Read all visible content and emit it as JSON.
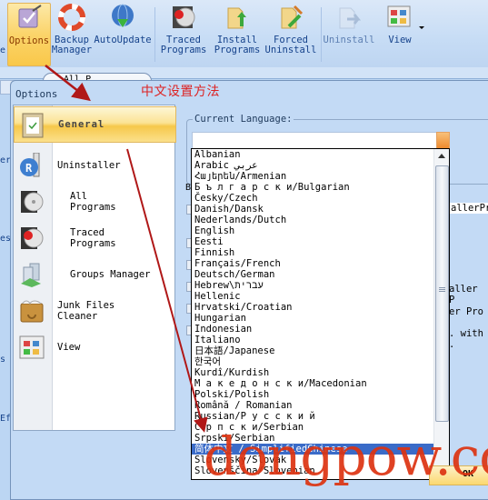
{
  "ribbon": {
    "buttons": [
      {
        "label": "Options",
        "icon": "options-icon",
        "active": true
      },
      {
        "label": "Backup\nManager",
        "icon": "lifebuoy-icon"
      },
      {
        "label": "AutoUpdate",
        "icon": "globe-update-icon"
      },
      {
        "label": "Traced\nPrograms",
        "icon": "traced-programs-icon"
      },
      {
        "label": "Install\nPrograms",
        "icon": "install-programs-icon"
      },
      {
        "label": "Forced\nUninstall",
        "icon": "forced-uninstall-icon"
      },
      {
        "label": "Uninstall",
        "icon": "uninstall-icon",
        "disabled": true
      },
      {
        "label": "View",
        "icon": "view-icon",
        "dropdown": true
      }
    ],
    "partial_left_label": "e"
  },
  "background": {
    "pill_text": "All P",
    "side_texts": [
      "er",
      "es",
      "s",
      "Ef"
    ]
  },
  "annotation": {
    "chinese_title": "中文设置方法",
    "watermark": "dongpow.com"
  },
  "dialog": {
    "title": "Options",
    "nav": [
      {
        "label": "General",
        "icon": "clipboard-check-icon",
        "selected": true
      },
      {
        "label": "Uninstaller",
        "icon": "uninstaller-icon"
      },
      {
        "label": "All\nPrograms",
        "icon": "all-programs-icon"
      },
      {
        "label": "Traced\nPrograms",
        "icon": "traced-programs-icon"
      },
      {
        "label": "Groups Manager",
        "icon": "groups-manager-icon"
      },
      {
        "label": "Junk Files\nCleaner",
        "icon": "junk-files-icon"
      },
      {
        "label": "View",
        "icon": "view-icon"
      }
    ],
    "current_language_label": "Current Language:",
    "current_language_value": "",
    "behind_texts": [
      "allerPr",
      "aller P",
      "er Pro",
      ". with ."
    ],
    "ok_label": "OK"
  },
  "language_dropdown": {
    "items": [
      "Albanian",
      "Arabic عربي",
      "Հայերեն/Armenian",
      "Б ъ л г а р с к и/Bulgarian",
      "Česky/Czech",
      "Danish/Dansk",
      "Nederlands/Dutch",
      "English",
      "Eesti",
      "Finnish",
      "Français/French",
      "Deutsch/German",
      "Hebrew\\עברית",
      "Hellenic",
      "Hrvatski/Croatian",
      "Hungarian",
      "Indonesian",
      "Italiano",
      "日本語/Japanese",
      "한국어",
      "Kurdî/Kurdish",
      "М а к е д о н с к и/Macedonian",
      "Polski/Polish",
      "Română / Romanian",
      "Russian/Р у с с к и й",
      "С р п с к и/Serbian",
      "Srpski/Serbian",
      "简体中文 / SimplifiedChinese",
      "Slovensky/Slovak",
      "Slovenščina/Slovenian"
    ],
    "highlighted_index": 27,
    "colors": {
      "highlight": "#3a6bc8"
    }
  },
  "colors": {
    "accent": "#fbd46a",
    "annotation_red": "#d22222",
    "ribbon_text": "#15428b"
  }
}
